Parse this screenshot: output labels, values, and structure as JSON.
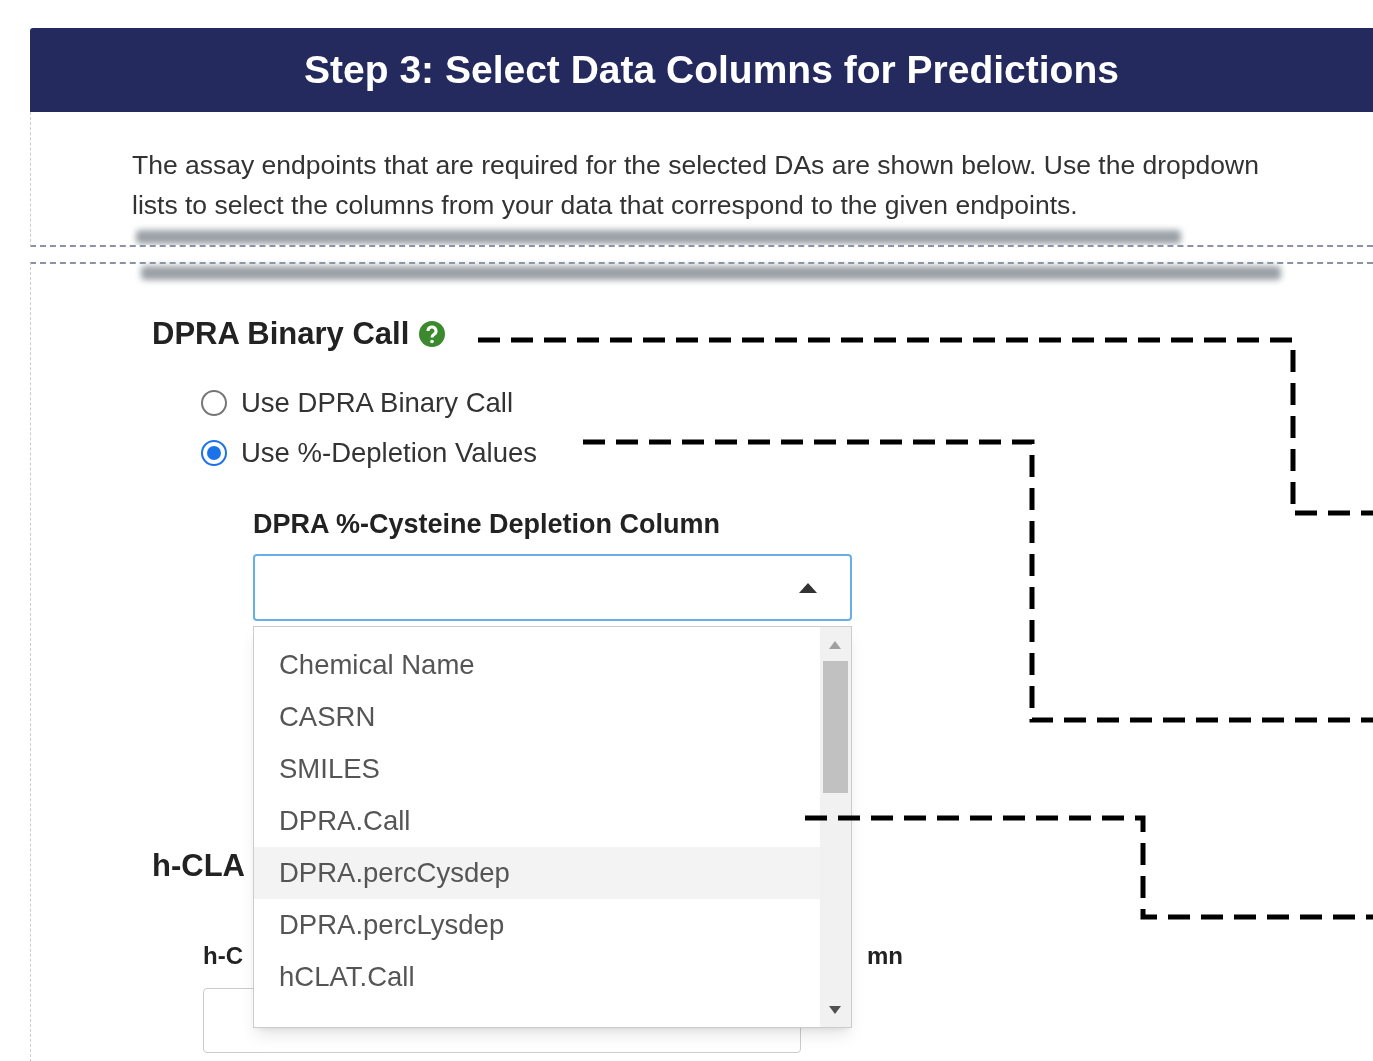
{
  "header": {
    "title": "Step 3: Select Data Columns for Predictions"
  },
  "intro": {
    "text": "The assay endpoints that are required for the selected DAs are shown below. Use the dropdown lists to select the columns from your data that correspond to the given endpoints."
  },
  "section": {
    "title": "DPRA Binary Call",
    "options": [
      {
        "label": "Use DPRA Binary Call",
        "selected": false
      },
      {
        "label": "Use %-Depletion Values",
        "selected": true
      }
    ],
    "field": {
      "label": "DPRA %-Cysteine Depletion Column",
      "expanded": true,
      "options": [
        {
          "label": "Chemical Name",
          "highlighted": false
        },
        {
          "label": "CASRN",
          "highlighted": false
        },
        {
          "label": "SMILES",
          "highlighted": false
        },
        {
          "label": "DPRA.Call",
          "highlighted": false
        },
        {
          "label": "DPRA.percCysdep",
          "highlighted": true
        },
        {
          "label": "DPRA.percLysdep",
          "highlighted": false
        },
        {
          "label": "hCLAT.Call",
          "highlighted": false
        }
      ]
    }
  },
  "next_section": {
    "title": "h-CLA",
    "field_label_start": "h-C",
    "field_label_end": "mn"
  }
}
